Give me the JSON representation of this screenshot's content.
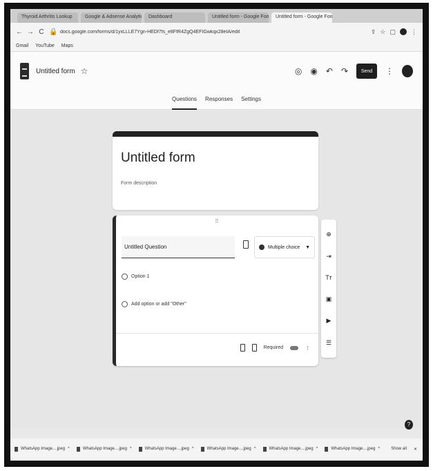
{
  "browser": {
    "tabs": [
      "Thyroid Arthritis Lookup",
      "Google & Adsense Analytics",
      "Dashboard",
      "Untitled form - Google Forms",
      "Untitled form - Google Forms"
    ],
    "url": "docs.google.com/forms/d/1yxLLLE7Ygn-HEDf7fs_e8FfR4ZgQ4EFIGwkqx28eIA/edit",
    "bookmarks": [
      "Gmail",
      "YouTube",
      "Maps"
    ]
  },
  "header": {
    "title": "Untitled form",
    "send_label": "Send"
  },
  "tabs": [
    "Questions",
    "Responses",
    "Settings"
  ],
  "form": {
    "title": "Untitled form",
    "description": "Form description"
  },
  "question": {
    "title": "Untitled Question",
    "type": "Multiple choice",
    "option1": "Option 1",
    "add_option": "Add option or add \"Other\"",
    "required_label": "Required"
  },
  "downloads": {
    "items": [
      "WhatsApp Image....jpeg",
      "WhatsApp Image....jpeg",
      "WhatsApp Image....jpeg",
      "WhatsApp Image....jpeg",
      "WhatsApp Image....jpeg",
      "WhatsApp Image....jpeg"
    ],
    "show_all": "Show all"
  }
}
